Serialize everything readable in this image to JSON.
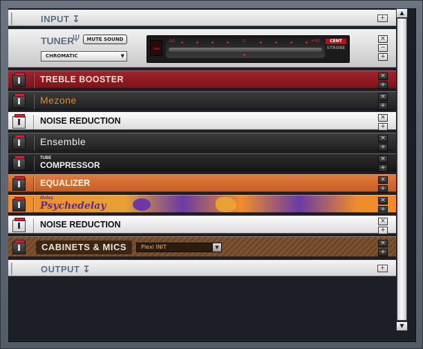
{
  "input": {
    "label": "INPUT",
    "add_symbol": "+"
  },
  "output": {
    "label": "OUTPUT",
    "add_symbol": "+"
  },
  "tuner": {
    "label": "TUNER",
    "mute_label": "MUTE SOUND",
    "mode_value": "CHROMATIC",
    "scale_left": "-50",
    "scale_center": "0",
    "scale_right": "+50",
    "cent_label": "CENT",
    "strobe_label": "STROBE"
  },
  "modules": [
    {
      "name": "TREBLE BOOSTER"
    },
    {
      "name": "Mezone"
    },
    {
      "name": "NOISE REDUCTION"
    },
    {
      "name": "Ensemble"
    },
    {
      "name_small": "TUBE",
      "name": "COMPRESSOR"
    },
    {
      "name": "EQUALIZER"
    },
    {
      "name_small": "Delay",
      "name": "Psychedelay"
    },
    {
      "name": "NOISE REDUCTION"
    },
    {
      "name": "CABINETS & MICS",
      "preset": "Plexi INIT"
    }
  ],
  "controls": {
    "close_symbol": "×",
    "add_symbol": "+",
    "minus_symbol": "−"
  },
  "scroll": {
    "up_symbol": "▲",
    "down_symbol": "▼"
  },
  "colors": {
    "accent_blue": "#5a6d83",
    "treble_red": "#9a2028",
    "mezone_orange": "#e38a2f",
    "equalizer_orange": "#d66b30",
    "psychedelay_purple": "#6b3aa6",
    "cabinet_brown": "#7c5430"
  }
}
